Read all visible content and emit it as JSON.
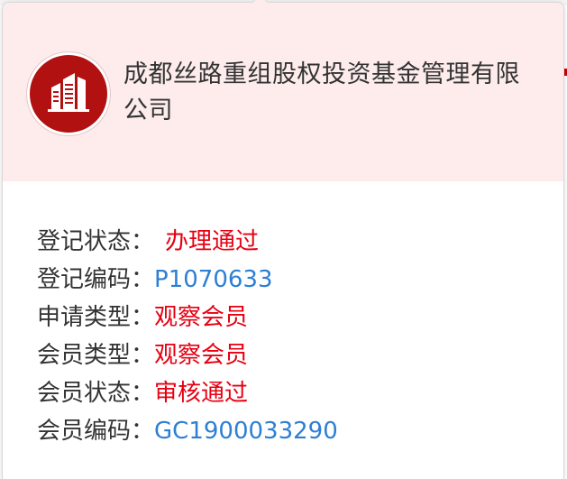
{
  "company": {
    "name": "成都丝路重组股权投资基金管理有限公司",
    "logo_icon": "building-icon",
    "logo_color": "#b21111",
    "header_bg": "#fdeceb"
  },
  "info_rows": [
    {
      "label": "登记状态：",
      "value": "办理通过",
      "color": "#e60012"
    },
    {
      "label": "登记编码：",
      "value": "P1070633",
      "color": "#2d7fd3"
    },
    {
      "label": "申请类型：",
      "value": "观察会员",
      "color": "#e60012"
    },
    {
      "label": "会员类型：",
      "value": "观察会员",
      "color": "#e60012"
    },
    {
      "label": "会员状态：",
      "value": "审核通过",
      "color": "#e60012"
    },
    {
      "label": "会员编码：",
      "value": "GC1900033290",
      "color": "#2d7fd3"
    }
  ]
}
